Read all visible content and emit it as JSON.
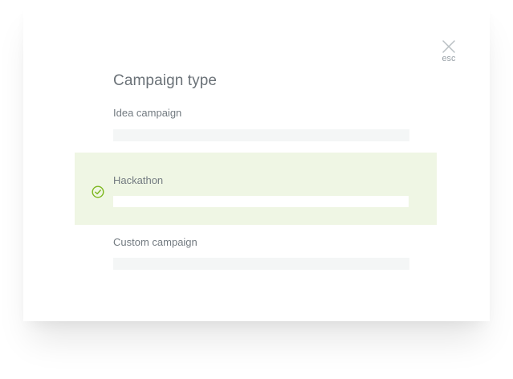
{
  "dialog": {
    "title": "Campaign type",
    "close": {
      "icon": "close-icon",
      "label": "esc"
    },
    "accent_color": "#7bb61c",
    "selected_background": "#eff6e4",
    "options": [
      {
        "label": "Idea campaign",
        "selected": false
      },
      {
        "label": "Hackathon",
        "selected": true,
        "icon": "check-circle-icon"
      },
      {
        "label": "Custom campaign",
        "selected": false
      }
    ]
  }
}
